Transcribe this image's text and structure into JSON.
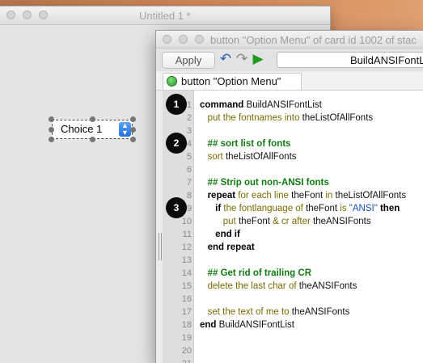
{
  "background_window": {
    "title": "Untitled 1 *",
    "choice_button": {
      "label": "Choice 1"
    }
  },
  "editor_window": {
    "title": "button \"Option Menu\" of card id 1002 of stac",
    "toolbar": {
      "apply_label": "Apply",
      "undo_icon": "undo-arrow-icon",
      "redo_icon": "redo-arrow-icon",
      "run_icon": "play-icon",
      "handler_value": "BuildANSIFontList"
    },
    "tab": {
      "label": "button \"Option Menu\"",
      "status_icon": "green-status-dot-icon"
    },
    "line_numbers": [
      "1",
      "2",
      "3",
      "4",
      "5",
      "6",
      "7",
      "8",
      "9",
      "10",
      "11",
      "12",
      "13",
      "14",
      "15",
      "16",
      "17",
      "18",
      "19",
      "20",
      "21"
    ],
    "code_lines": [
      [
        {
          "t": "command",
          "c": "kw"
        },
        {
          "t": " BuildANSIFontList",
          "c": "plain"
        }
      ],
      [
        {
          "t": "   put the fontnames into",
          "c": "sub"
        },
        {
          "t": " theListOfAllFonts",
          "c": "plain"
        }
      ],
      [],
      [
        {
          "t": "   ## sort list of fonts",
          "c": "cmt"
        }
      ],
      [
        {
          "t": "   sort",
          "c": "sub"
        },
        {
          "t": " theListOfAllFonts",
          "c": "plain"
        }
      ],
      [],
      [
        {
          "t": "   ## Strip out non-ANSI fonts",
          "c": "cmt"
        }
      ],
      [
        {
          "t": "   repeat",
          "c": "kw"
        },
        {
          "t": " for each line",
          "c": "sub"
        },
        {
          "t": " theFont",
          "c": "plain"
        },
        {
          "t": " in",
          "c": "sub"
        },
        {
          "t": " theListOfAllFonts",
          "c": "plain"
        }
      ],
      [
        {
          "t": "      if",
          "c": "kw"
        },
        {
          "t": " the fontlanguage of",
          "c": "sub"
        },
        {
          "t": " theFont",
          "c": "plain"
        },
        {
          "t": " is",
          "c": "sub"
        },
        {
          "t": " \"ANSI\"",
          "c": "str"
        },
        {
          "t": " then",
          "c": "kw"
        }
      ],
      [
        {
          "t": "         put",
          "c": "sub"
        },
        {
          "t": " theFont",
          "c": "plain"
        },
        {
          "t": " & cr after",
          "c": "sub"
        },
        {
          "t": " theANSIFonts",
          "c": "plain"
        }
      ],
      [
        {
          "t": "      end if",
          "c": "kw"
        }
      ],
      [
        {
          "t": "   end repeat",
          "c": "kw"
        }
      ],
      [],
      [
        {
          "t": "   ## Get rid of trailing CR",
          "c": "cmt"
        }
      ],
      [
        {
          "t": "   delete the last char of",
          "c": "sub"
        },
        {
          "t": " theANSIFonts",
          "c": "plain"
        }
      ],
      [],
      [
        {
          "t": "   set the text of me to",
          "c": "sub"
        },
        {
          "t": " theANSIFonts",
          "c": "plain"
        }
      ],
      [
        {
          "t": "end",
          "c": "kw"
        },
        {
          "t": " BuildANSIFontList",
          "c": "plain"
        }
      ],
      [],
      [],
      []
    ],
    "callouts": [
      {
        "label": "1",
        "line": 1
      },
      {
        "label": "2",
        "line": 4
      },
      {
        "label": "3",
        "line": 9
      }
    ]
  },
  "colors": {
    "kw": "#000000",
    "sub": "#7a6a00",
    "cmt": "#117a11",
    "str": "#1a4fb8",
    "plain": "#111111"
  }
}
